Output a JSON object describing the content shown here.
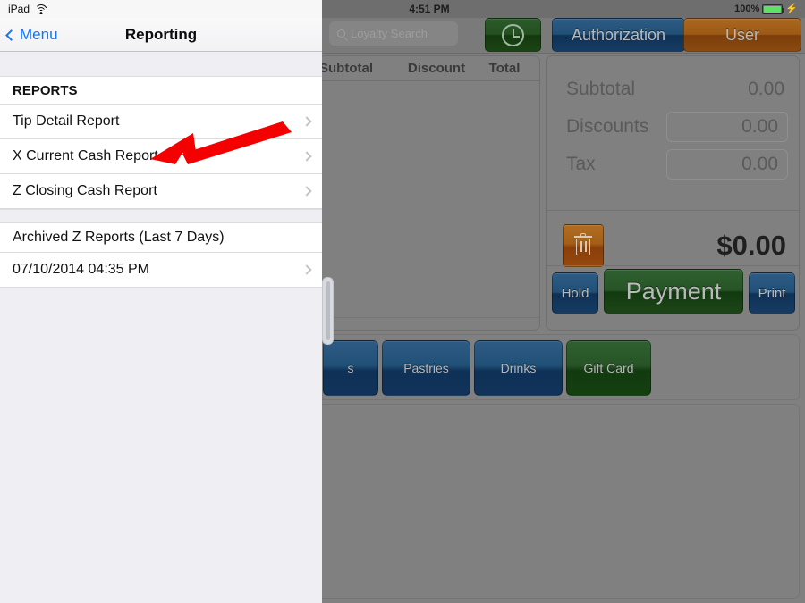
{
  "sidebar": {
    "status": {
      "device": "iPad",
      "wifi_icon": "wifi-icon"
    },
    "navbar": {
      "back_label": "Menu",
      "back_icon": "chevron-left-icon",
      "title": "Reporting"
    },
    "sections": [
      {
        "header": "REPORTS",
        "rows": [
          {
            "label": "Tip Detail Report",
            "accessory": "chevron-right-icon"
          },
          {
            "label": "X Current Cash Report",
            "accessory": "chevron-right-icon"
          },
          {
            "label": "Z Closing Cash Report",
            "accessory": "chevron-right-icon"
          }
        ]
      },
      {
        "header": "Archived Z Reports (Last 7 Days)",
        "rows": [
          {
            "label": "07/10/2014 04:35 PM",
            "accessory": "chevron-right-icon"
          }
        ]
      }
    ]
  },
  "annotation": {
    "type": "arrow",
    "color": "#f40000",
    "points_to": "X Current Cash Report"
  },
  "pos": {
    "statusbar": {
      "time": "4:51 PM",
      "battery_percent": "100%",
      "battery_icon": "battery-full-icon",
      "charging_icon": "lightning-bolt-icon"
    },
    "topbar": {
      "search_placeholder": "Loyalty Search",
      "search_icon": "search-icon",
      "clock_button_icon": "clock-icon",
      "authorization_label": "Authorization",
      "user_label": "User"
    },
    "order": {
      "columns": [
        "Subtotal",
        "Discount",
        "Total"
      ],
      "rows": []
    },
    "totals": {
      "subtotal_label": "Subtotal",
      "subtotal_value": "0.00",
      "discounts_label": "Discounts",
      "discounts_value": "0.00",
      "tax_label": "Tax",
      "tax_value": "0.00",
      "grand_total": "$0.00",
      "trash_icon": "trash-icon",
      "hold_label": "Hold",
      "payment_label": "Payment",
      "print_label": "Print"
    },
    "categories": [
      {
        "label": "s",
        "color": "blue"
      },
      {
        "label": "Pastries",
        "color": "blue"
      },
      {
        "label": "Drinks",
        "color": "blue"
      },
      {
        "label": "Gift Card",
        "color": "green"
      }
    ]
  },
  "colors": {
    "accent_blue": "#1076ff",
    "annotation_red": "#f40000",
    "button_blue": "#215077",
    "button_green": "#275426",
    "button_orange": "#9c5a17"
  }
}
